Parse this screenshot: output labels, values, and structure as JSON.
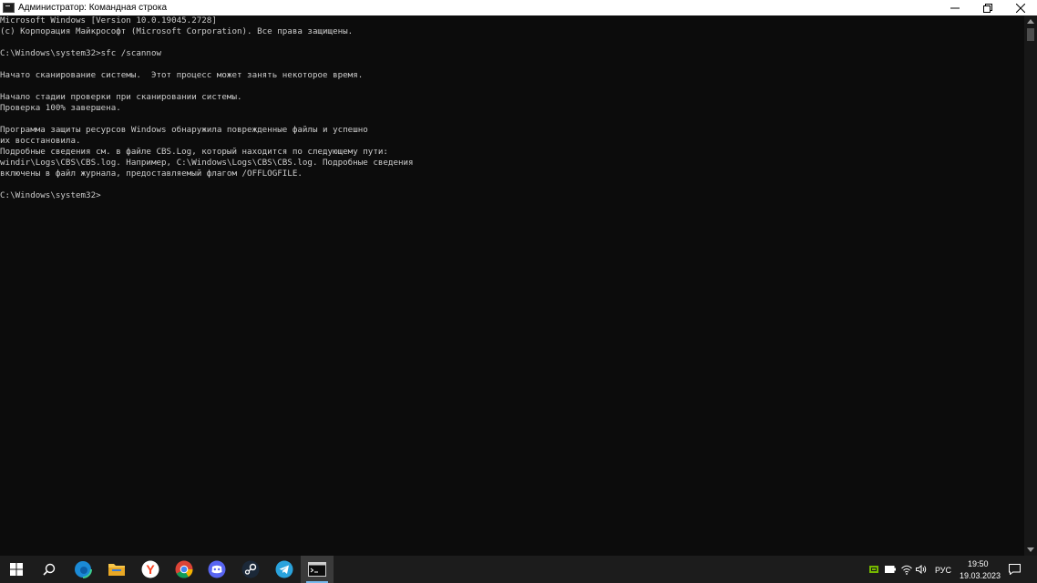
{
  "window": {
    "title": "Администратор: Командная строка"
  },
  "console": {
    "lines": [
      "Microsoft Windows [Version 10.0.19045.2728]",
      "(c) Корпорация Майкрософт (Microsoft Corporation). Все права защищены.",
      "",
      "C:\\Windows\\system32>sfc /scannow",
      "",
      "Начато сканирование системы.  Этот процесс может занять некоторое время.",
      "",
      "Начало стадии проверки при сканировании системы.",
      "Проверка 100% завершена.",
      "",
      "Программа защиты ресурсов Windows обнаружила поврежденные файлы и успешно",
      "их восстановила.",
      "Подробные сведения см. в файле CBS.Log, который находится по следующему пути:",
      "windir\\Logs\\CBS\\CBS.log. Например, C:\\Windows\\Logs\\CBS\\CBS.log. Подробные сведения",
      "включены в файл журнала, предоставляемый флагом /OFFLOGFILE.",
      "",
      "C:\\Windows\\system32>"
    ]
  },
  "taskbar": {
    "apps": [
      {
        "name": "start-button",
        "icon": "windows-logo-icon"
      },
      {
        "name": "search-button",
        "icon": "search-icon"
      },
      {
        "name": "edge-app",
        "icon": "edge-icon"
      },
      {
        "name": "file-explorer-app",
        "icon": "folder-icon"
      },
      {
        "name": "yandex-browser-app",
        "icon": "yandex-icon"
      },
      {
        "name": "chrome-app",
        "icon": "chrome-icon"
      },
      {
        "name": "discord-app",
        "icon": "discord-icon"
      },
      {
        "name": "steam-app",
        "icon": "steam-icon"
      },
      {
        "name": "telegram-app",
        "icon": "telegram-icon"
      },
      {
        "name": "cmd-app",
        "icon": "cmd-icon"
      }
    ],
    "tray": {
      "language": "РУС",
      "time": "19:50",
      "date": "19.03.2023"
    },
    "colors": {
      "accent": "#76b9ed",
      "nvidia": "#76b900"
    }
  }
}
